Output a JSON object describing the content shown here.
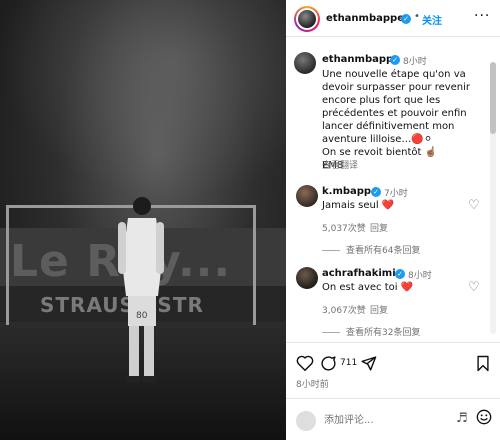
{
  "header": {
    "username": "ethanmbappe",
    "dot": "•",
    "follow_label": "关注",
    "more": "···"
  },
  "photo": {
    "board_text": "Le Roy...",
    "ad_text": "STRAUSS  STR",
    "kit_number": "80"
  },
  "caption": {
    "username": "ethanmbappe",
    "time": "8小时",
    "text": "Une nouvelle étape qu'on va devoir surpasser pour revenir encore plus fort que les précédentes et pouvoir enfin lancer définitivement mon aventure lilloise…🔴⚪\nOn se revoit bientôt ☝🏽\nEM8",
    "translate": "查看翻译"
  },
  "comments": [
    {
      "username": "k.mbappe",
      "time": "7小时",
      "text": "Jamais seul ❤️",
      "likes": "5,037次赞",
      "reply": "回复",
      "view_replies": "查看所有64条回复"
    },
    {
      "username": "achrafhakimi",
      "time": "8小时",
      "text": "On est avec toi ❤️",
      "likes": "3,067次赞",
      "reply": "回复",
      "view_replies": "查看所有32条回复"
    }
  ],
  "actions": {
    "comment_count": "711",
    "time_ago": "8小时前"
  },
  "composer": {
    "placeholder": "添加评论..."
  },
  "colors": {
    "accent": "#0095f6",
    "verified": "#1d9bf0",
    "secondary_text": "#737373"
  }
}
